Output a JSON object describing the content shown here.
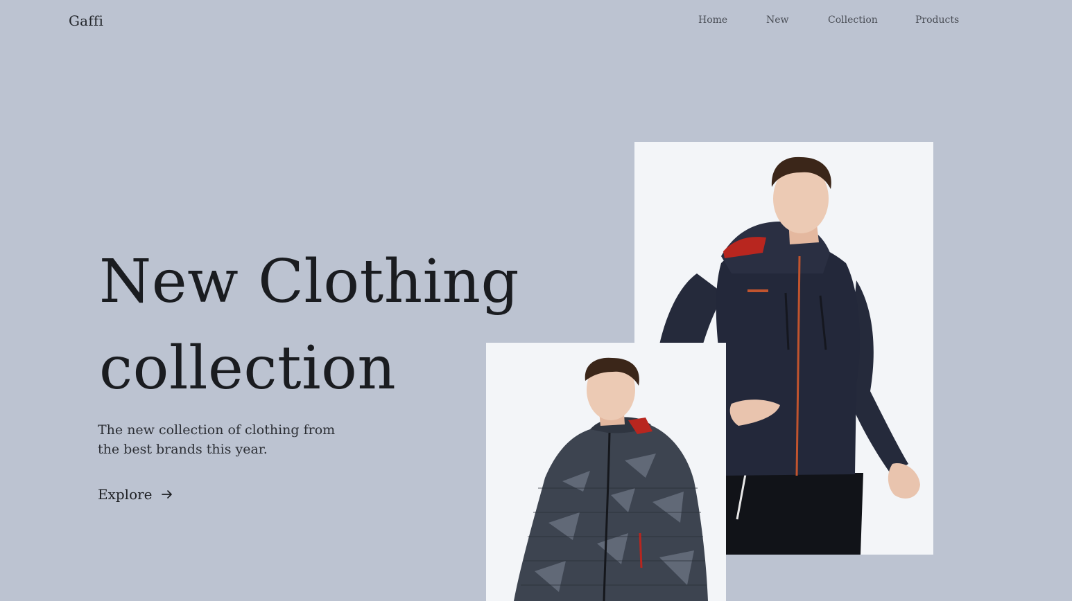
{
  "header": {
    "logo": "Gaffi",
    "nav": [
      {
        "label": "Home"
      },
      {
        "label": "New"
      },
      {
        "label": "Collection"
      },
      {
        "label": "Products"
      }
    ]
  },
  "hero": {
    "title_line1": "New Clothing",
    "title_line2": "collection",
    "subtitle": "The new collection of clothing from the best brands this year.",
    "cta_label": "Explore",
    "cta_icon": "arrow-right-icon"
  },
  "images": {
    "large": {
      "subject": "man-in-navy-ski-jacket"
    },
    "small": {
      "subject": "man-in-camo-puffer-jacket"
    }
  },
  "colors": {
    "background": "#bcc3d1",
    "photo_background": "#f3f5f8",
    "text": "#1d1f23",
    "nav_text": "#4a4e56",
    "jacket_navy": "#23283a",
    "accent_red": "#b8261f"
  }
}
